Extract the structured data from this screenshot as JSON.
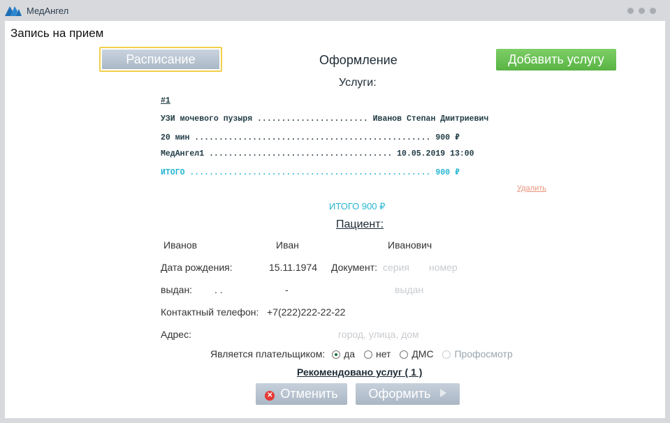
{
  "app": {
    "title": "МедАнгел"
  },
  "page": {
    "title": "Запись на прием"
  },
  "toolbar": {
    "schedule_label": "Расписание",
    "center_title": "Оформление",
    "add_service_label": "Добавить услугу"
  },
  "services": {
    "title": "Услуги:",
    "number": "#1",
    "lines": [
      "УЗИ мочевого пузыря ....................... Иванов Степан Дмитриевич",
      "20 мин ................................................. 900 ₽",
      "МедАнгел1 ...................................... 10.05.2019  13:00"
    ],
    "total_line": "ИТОГО .................................................. 900 ₽",
    "delete_label": "Удалить",
    "grand_total": "ИТОГО 900 ₽"
  },
  "patient": {
    "title": "Пациент:",
    "last_name": "Иванов",
    "first_name": "Иван",
    "middle_name": "Иванович",
    "birth_label": "Дата рождения:",
    "birth_date": "15.11.1974",
    "doc_label": "Документ:",
    "series_placeholder": "серия",
    "number_placeholder": "номер",
    "issued_label": "выдан:",
    "issued_date": ". .",
    "issued_dash": "-",
    "issued_placeholder": "выдан",
    "phone_label": "Контактный телефон:",
    "phone": "+7(222)222-22-22",
    "address_label": "Адрес:",
    "address_placeholder": "город, улица, дом"
  },
  "payer": {
    "label": "Является плательщиком:",
    "options": [
      "да",
      "нет",
      "ДМС",
      "Профосмотр"
    ],
    "selected": "да"
  },
  "recommended": "Рекомендовано услуг ( 1 )",
  "actions": {
    "cancel_label": "Отменить",
    "submit_label": "Оформить"
  },
  "colors": {
    "accent_green": "#5cb847",
    "accent_cyan": "#25b6d2",
    "danger": "#e53935"
  }
}
